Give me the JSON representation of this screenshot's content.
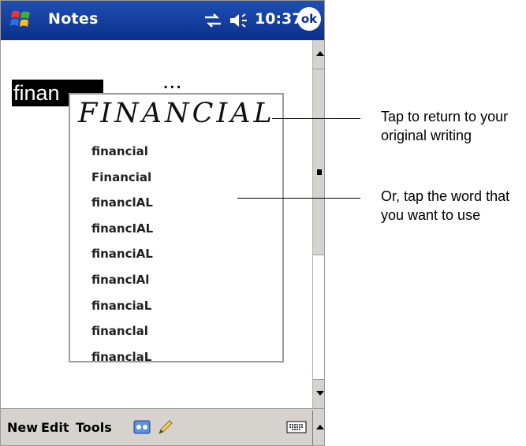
{
  "titlebar": {
    "app_title": "Notes",
    "clock": "10:37",
    "ok_label": "ok"
  },
  "note": {
    "selected_text": "finan",
    "trailing_text": "..."
  },
  "alternates": {
    "handwriting": "FINANCIAL",
    "items": [
      "financial",
      "Financial",
      "financlAL",
      "financIAL",
      "financiAL",
      "financlAl",
      "financiaL",
      "financlal",
      "financlaL"
    ]
  },
  "menubar": {
    "new_label": "New",
    "edit_label": "Edit",
    "tools_label": "Tools"
  },
  "callouts": {
    "return_text": "Tap to return to your original writing",
    "word_text": "Or, tap the word that you want to use"
  },
  "colors": {
    "titlebar": "#0b2f8c",
    "menubar": "#d6d3ce",
    "popup_border": "#9d9d9d"
  },
  "icons": [
    "windows-start-icon",
    "connectivity-icon",
    "speaker-icon",
    "recording-icon",
    "pen-icon",
    "keyboard-icon"
  ]
}
